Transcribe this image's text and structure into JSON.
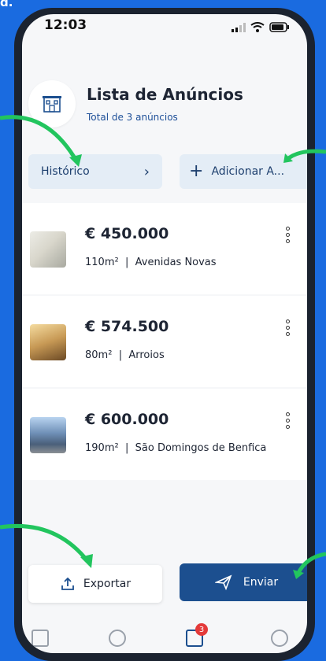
{
  "corner_text": "d.",
  "status_bar": {
    "time": "12:03"
  },
  "header": {
    "title": "Lista de Anúncios",
    "subtitle": "Total de 3 anúncios",
    "icon": "building-icon"
  },
  "actions": {
    "history_label": "Histórico",
    "add_label": "Adicionar A..."
  },
  "listings": [
    {
      "price": "€ 450.000",
      "area": "110m²",
      "location": "Avenidas Novas"
    },
    {
      "price": "€ 574.500",
      "area": "80m²",
      "location": "Arroios"
    },
    {
      "price": "€ 600.000",
      "area": "190m²",
      "location": "São Domingos de Benfica"
    }
  ],
  "footer": {
    "export_label": "Exportar",
    "send_label": "Enviar"
  },
  "tabbar": {
    "badge_count": "3"
  },
  "colors": {
    "background": "#1a6be0",
    "primary": "#1c4f8f",
    "light_button": "#e4edf6",
    "annotation_arrow": "#22c55e",
    "badge": "#e43a3a"
  }
}
